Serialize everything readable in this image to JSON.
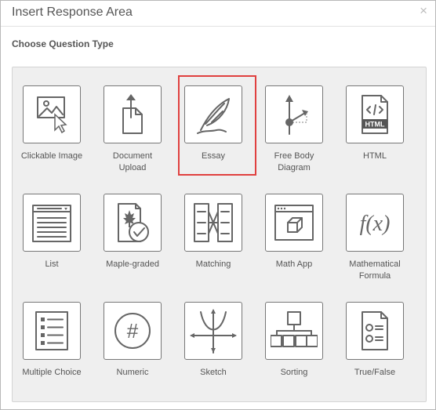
{
  "dialog": {
    "title": "Insert Response Area",
    "close_glyph": "×",
    "subtitle": "Choose Question Type"
  },
  "tiles": [
    {
      "label": "Clickable Image",
      "icon": "clickable-image-icon"
    },
    {
      "label": "Document Upload",
      "icon": "document-upload-icon"
    },
    {
      "label": "Essay",
      "icon": "quill-feather-icon",
      "selected": true
    },
    {
      "label": "Free Body Diagram",
      "icon": "free-body-diagram-icon"
    },
    {
      "label": "HTML",
      "icon": "html-file-icon"
    },
    {
      "label": "List",
      "icon": "list-dropdown-icon"
    },
    {
      "label": "Maple-graded",
      "icon": "maple-leaf-check-icon"
    },
    {
      "label": "Matching",
      "icon": "matching-columns-icon"
    },
    {
      "label": "Math App",
      "icon": "math-app-window-icon"
    },
    {
      "label": "Mathematical Formula",
      "icon": "fx-formula-icon",
      "glyph": "f(x)"
    },
    {
      "label": "Multiple Choice",
      "icon": "multiple-choice-list-icon"
    },
    {
      "label": "Numeric",
      "icon": "hash-circle-icon",
      "glyph": "#"
    },
    {
      "label": "Sketch",
      "icon": "sketch-graph-icon"
    },
    {
      "label": "Sorting",
      "icon": "sorting-tree-icon"
    },
    {
      "label": "True/False",
      "icon": "true-false-icon"
    }
  ],
  "colors": {
    "selection_border": "#e0403f",
    "panel_background": "#efefef",
    "icon": "#666666"
  }
}
